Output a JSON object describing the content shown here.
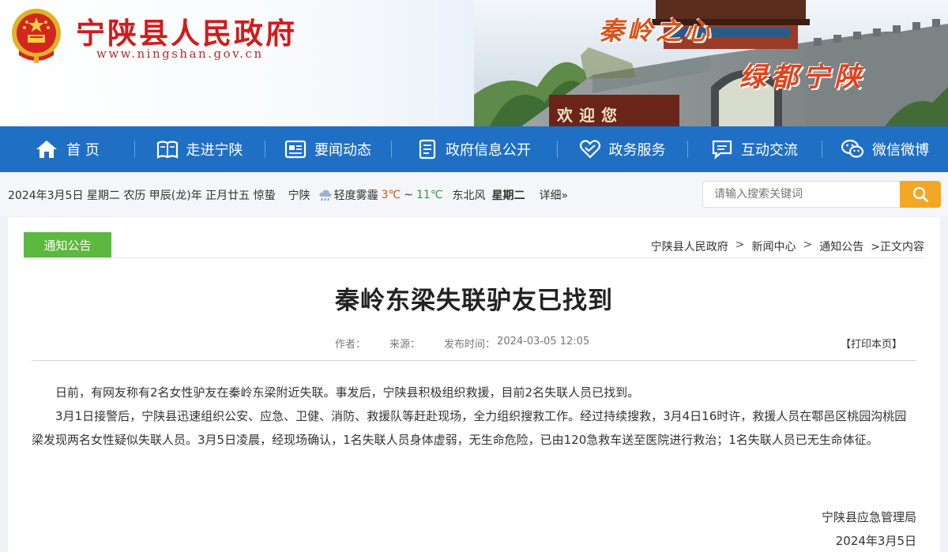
{
  "header": {
    "site_title": "宁陕县人民政府",
    "site_url": "www.ningshan.gov.cn",
    "slogan_1": "秦岭之心",
    "slogan_2": "绿都宁陕",
    "welcome_sign": "欢迎您",
    "colors": {
      "title": "#d11b1b",
      "nav": "#1f70c4",
      "slogan": "#e2421b"
    }
  },
  "nav": {
    "items": [
      {
        "label": "首 页",
        "icon": "home-icon"
      },
      {
        "label": "走进宁陕",
        "icon": "book-icon"
      },
      {
        "label": "要闻动态",
        "icon": "news-icon"
      },
      {
        "label": "政府信息公开",
        "icon": "document-icon"
      },
      {
        "label": "政务服务",
        "icon": "heart-icon"
      },
      {
        "label": "互动交流",
        "icon": "chat-icon"
      },
      {
        "label": "微信微博",
        "icon": "wechat-icon"
      }
    ]
  },
  "infobar": {
    "date_text": "2024年3月5日 星期二 农历 甲辰(龙)年 正月廿五 惊蛰",
    "city": "宁陕",
    "weather_icon": "cloud-rain-icon",
    "weather": "轻度雾霾",
    "temp_low": "3℃",
    "tilde": "~",
    "temp_high": "11℃",
    "wind": "东北风",
    "weekday": "星期二",
    "detail_link": "详细»",
    "search_placeholder": "请输入搜索关键词",
    "search_icon": "search-icon"
  },
  "breadcrumb": {
    "section_tag": "通知公告",
    "items": [
      "宁陕县人民政府",
      "新闻中心",
      "通知公告"
    ],
    "separator": ">",
    "current": ">正文内容"
  },
  "article": {
    "title": "秦岭东梁失联驴友已找到",
    "author_label": "作者：",
    "source_label": "来源：",
    "publish_label": "发布时间：",
    "publish_time": "2024-03-05 12:05",
    "print_label": "【打印本页】",
    "paragraphs": [
      "日前，有网友称有2名女性驴友在秦岭东梁附近失联。事发后，宁陕县积极组织救援，目前2名失联人员已找到。",
      "3月1日接警后，宁陕县迅速组织公安、应急、卫健、消防、救援队等赶赴现场，全力组织搜救工作。经过持续搜救，3月4日16时许，救援人员在鄠邑区桃园沟桃园梁发现两名女性疑似失联人员。3月5日凌晨，经现场确认，1名失联人员身体虚弱，无生命危险，已由120急救车送至医院进行救治；1名失联人员已无生命体征。"
    ],
    "signature_org": "宁陕县应急管理局",
    "signature_date": "2024年3月5日"
  }
}
